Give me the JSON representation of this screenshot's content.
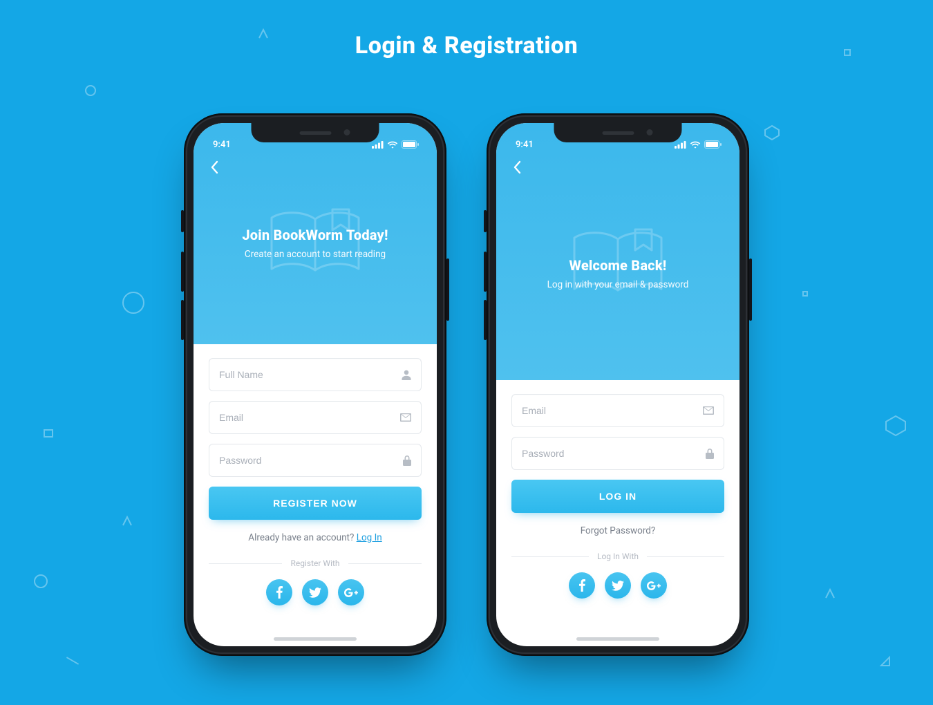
{
  "page_title": "Login & Registration",
  "status": {
    "time": "9:41"
  },
  "registration": {
    "title": "Join BookWorm Today!",
    "subtitle": "Create an account to start reading",
    "fields": {
      "name_placeholder": "Full Name",
      "email_placeholder": "Email",
      "password_placeholder": "Password"
    },
    "primary_button": "REGISTER NOW",
    "alt_prompt_text": "Already have an account? ",
    "alt_prompt_link": "Log In",
    "social_label": "Register With"
  },
  "login": {
    "title": "Welcome Back!",
    "subtitle": "Log in with your email & password",
    "fields": {
      "email_placeholder": "Email",
      "password_placeholder": "Password"
    },
    "primary_button": "LOG IN",
    "forgot_text": "Forgot Password?",
    "social_label": "Log In With"
  },
  "social_buttons": [
    "facebook",
    "twitter",
    "google-plus"
  ],
  "colors": {
    "background": "#14a7e6",
    "hero": "#3cb8ec",
    "button": "#2cb8ec",
    "text_muted": "#a9afb8"
  }
}
